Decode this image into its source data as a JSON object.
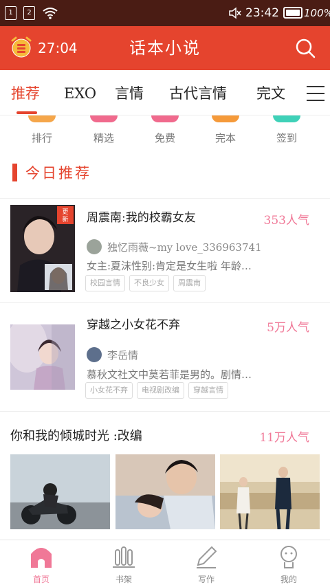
{
  "status_bar": {
    "sim1": "1",
    "sim2": "2",
    "time": "23:42",
    "battery": "100%"
  },
  "header": {
    "timer": "27:04",
    "title": "话本小说",
    "accent_color": "#e5442e"
  },
  "tabs": [
    {
      "label": "推荐",
      "active": true
    },
    {
      "label": "EXO",
      "active": false
    },
    {
      "label": "言情",
      "active": false
    },
    {
      "label": "古代言情",
      "active": false
    },
    {
      "label": "完文",
      "active": false
    }
  ],
  "categories": [
    {
      "label": "排行",
      "color": "#f5a64a"
    },
    {
      "label": "精选",
      "color": "#f06a8d"
    },
    {
      "label": "免费",
      "color": "#f06a8d"
    },
    {
      "label": "完本",
      "color": "#f59a3a"
    },
    {
      "label": "签到",
      "color": "#3fd1b8"
    }
  ],
  "section": {
    "title": "今日推荐"
  },
  "books": [
    {
      "title": "周震南:我的校霸女友",
      "popularity": "353人气",
      "badge": "更新",
      "author": "独忆雨薇~my love_336963741",
      "description": "女主:夏沫性别:肯定是女生啦 年龄…",
      "tags": [
        "校园言情",
        "不良少女",
        "周震南"
      ]
    },
    {
      "title": "穿越之小女花不弃",
      "popularity": "5万人气",
      "author": "李岳情",
      "description": "慕秋文社文中莫若菲是男的。剧情…",
      "tags": [
        "小女花不弃",
        "电视剧改编",
        "穿越言情"
      ]
    }
  ],
  "feature": {
    "title": "你和我的倾城时光 :改编",
    "popularity": "11万人气"
  },
  "bottom_nav": [
    {
      "label": "首页",
      "active": true
    },
    {
      "label": "书架",
      "active": false
    },
    {
      "label": "写作",
      "active": false
    },
    {
      "label": "我的",
      "active": false
    }
  ]
}
